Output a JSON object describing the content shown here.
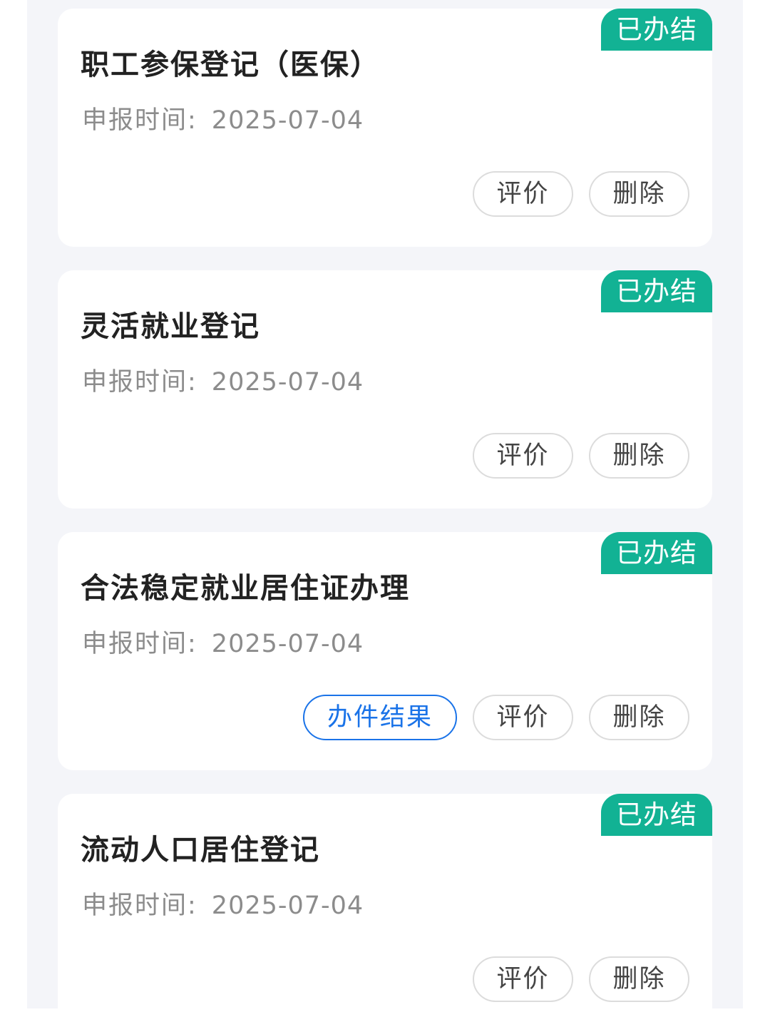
{
  "records": [
    {
      "title": "职工参保登记（医保）",
      "status": "已办结",
      "meta_label": "申报时间:",
      "date": "2025-07-04",
      "actions": {
        "evaluate": "评价",
        "delete": "删除"
      }
    },
    {
      "title": "灵活就业登记",
      "status": "已办结",
      "meta_label": "申报时间:",
      "date": "2025-07-04",
      "actions": {
        "evaluate": "评价",
        "delete": "删除"
      }
    },
    {
      "title": "合法稳定就业居住证办理",
      "status": "已办结",
      "meta_label": "申报时间:",
      "date": "2025-07-04",
      "actions": {
        "result": "办件结果",
        "evaluate": "评价",
        "delete": "删除"
      }
    },
    {
      "title": "流动人口居住登记",
      "status": "已办结",
      "meta_label": "申报时间:",
      "date": "2025-07-04",
      "actions": {
        "evaluate": "评价",
        "delete": "删除"
      }
    }
  ],
  "colors": {
    "badge": "#12b294",
    "accent_blue": "#1a73e8",
    "page_background": "#f4f5f9"
  }
}
